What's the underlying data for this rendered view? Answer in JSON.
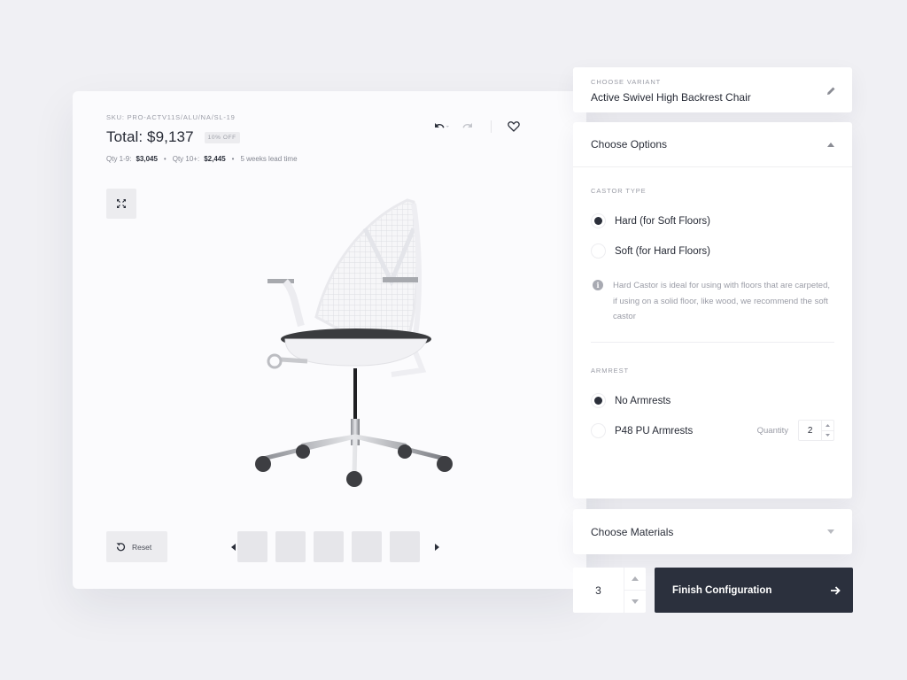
{
  "product": {
    "sku": "SKU: PRO-ACTV11S/ALU/NA/SL-19",
    "total": "Total: $9,137",
    "discount_badge": "10% OFF",
    "tier1_label": "Qty 1-9:",
    "tier1_price": "$3,045",
    "tier2_label": "Qty 10+:",
    "tier2_price": "$2,445",
    "lead_time": "5 weeks lead time",
    "separator": "•"
  },
  "toolbar": {
    "icons": [
      "undo-icon",
      "redo-icon",
      "heart-icon",
      "expand-icon"
    ]
  },
  "gallery": {
    "reset_label": "Reset",
    "thumbnail_count": 5
  },
  "variant": {
    "label": "CHOOSE VARIANT",
    "name": "Active Swivel High Backrest Chair"
  },
  "options": {
    "title": "Choose Options",
    "castor": {
      "label": "CASTOR TYPE",
      "choices": [
        {
          "label": "Hard (for Soft Floors)",
          "selected": true
        },
        {
          "label": "Soft (for Hard Floors)",
          "selected": false
        }
      ],
      "info": "Hard Castor is ideal for using with floors that are carpeted, if using on a solid floor, like wood, we recommend the soft castor"
    },
    "armrest": {
      "label": "ARMREST",
      "choices": [
        {
          "label": "No Armrests",
          "selected": true
        },
        {
          "label": "P48 PU Armrests",
          "selected": false
        }
      ],
      "quantity_label": "Quantity",
      "quantity_value": "2"
    }
  },
  "materials": {
    "title": "Choose Materials"
  },
  "checkout": {
    "quantity": "3",
    "finish_label": "Finish Configuration"
  },
  "colors": {
    "primary": "#2b303d",
    "background": "#f0f0f4"
  }
}
